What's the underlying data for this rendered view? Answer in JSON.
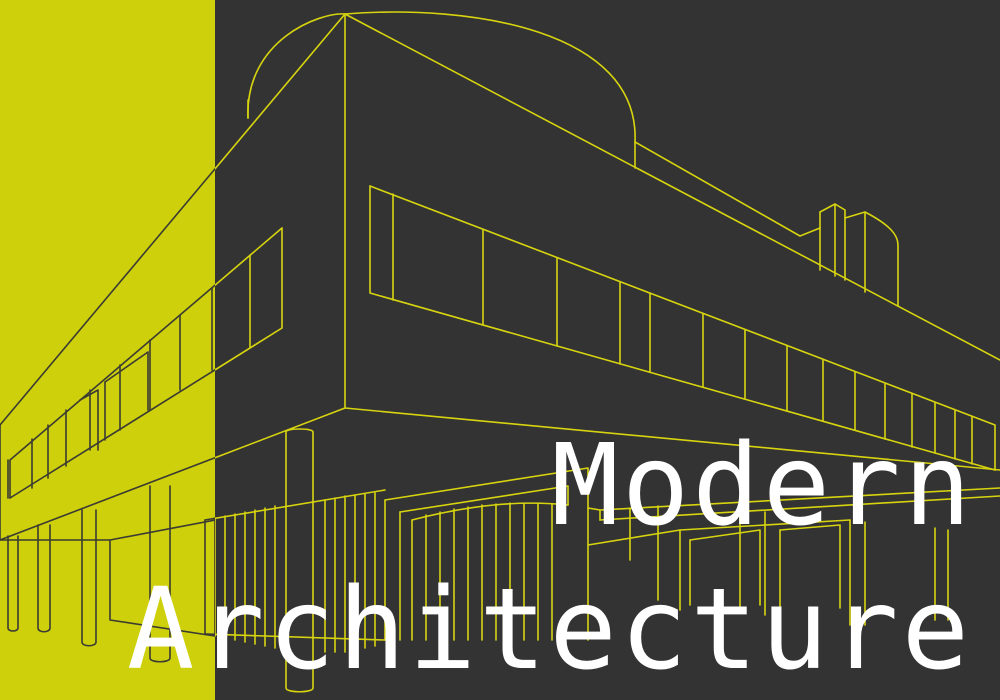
{
  "poster": {
    "title_line_1": "Modern",
    "title_line_2": "Architecture"
  },
  "colors": {
    "background_dark": "#333333",
    "accent_band": "#cdd00a",
    "line_on_dark": "#d7d40f",
    "line_on_accent": "#3b3b33",
    "title_text": "#ffffff"
  },
  "illustration": {
    "subject": "line drawing of a modernist house raised on pilotis",
    "icon": "building-outline-icon"
  }
}
